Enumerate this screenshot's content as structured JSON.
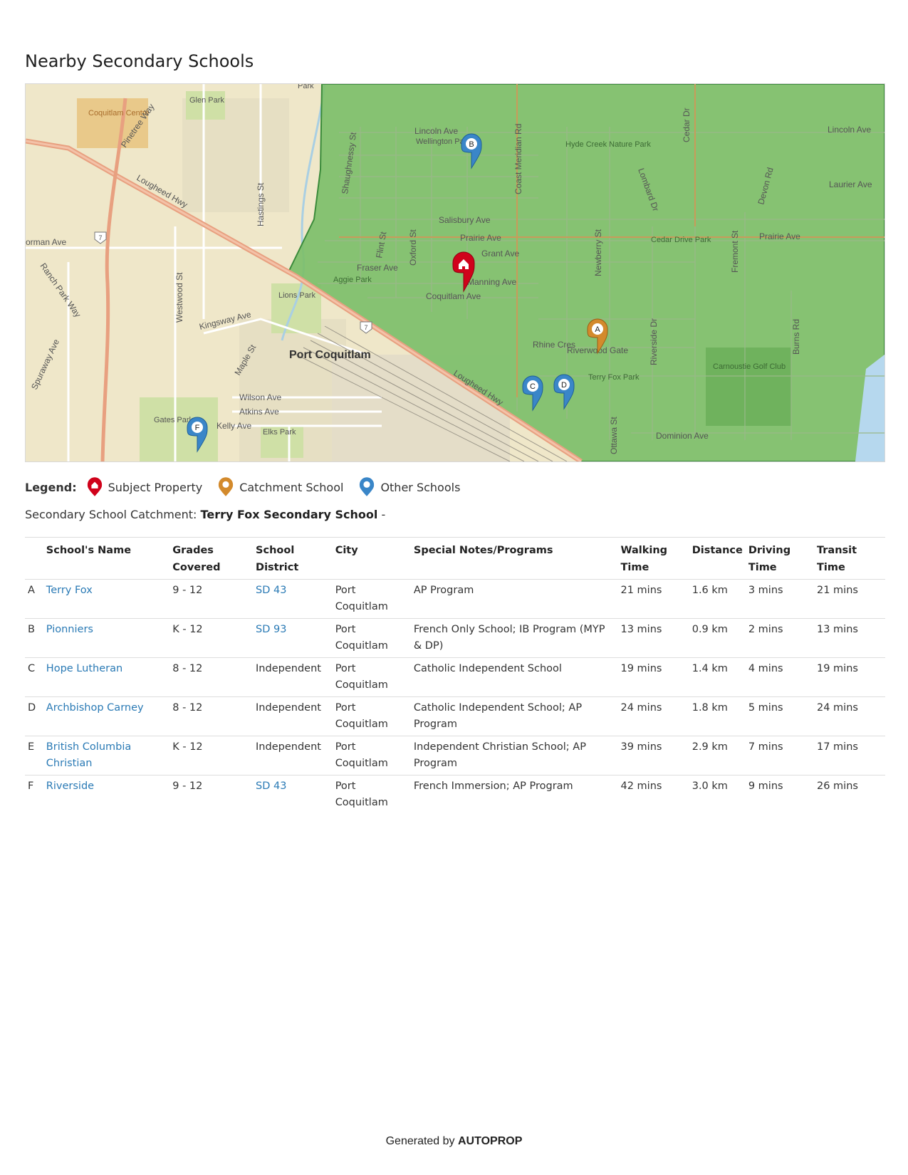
{
  "page_title": "Nearby Secondary Schools",
  "map": {
    "area_labels": {
      "glen_park": "Glen Park",
      "coquitlam_centre": "Coquitlam Centre",
      "port_coquitlam": "Port Coquitlam",
      "hyde_creek": "Hyde Creek Nature Park",
      "cedar_drive_park": "Cedar Drive Park",
      "lions_park": "Lions Park",
      "aggie_park": "Aggie Park",
      "terry_fox_park": "Terry Fox Park",
      "carnoustie": "Carnoustie Golf Club",
      "gates_park": "Gates Park",
      "elks_park": "Elks Park",
      "wellington_park": "Wellington Park",
      "park_top": "Park"
    },
    "street_labels": {
      "lincoln_ave": "Lincoln Ave",
      "lincoln_ave_east": "Lincoln Ave",
      "laurier_ave": "Laurier Ave",
      "salisbury_ave": "Salisbury Ave",
      "prairie_ave": "Prairie Ave",
      "prairie_ave_east": "Prairie Ave",
      "grant_ave": "Grant Ave",
      "fraser_ave": "Fraser Ave",
      "manning_ave": "Manning Ave",
      "coquitlam_ave": "Coquitlam Ave",
      "riverwood_gate": "Riverwood Gate",
      "dominion_ave": "Dominion Ave",
      "wilson_ave": "Wilson Ave",
      "atkins_ave": "Atkins Ave",
      "kelly_ave": "Kelly Ave",
      "kingsway_ave": "Kingsway Ave",
      "lougheed_hwy_w": "Lougheed Hwy",
      "lougheed_hwy_e": "Lougheed Hwy",
      "norman_ave": "orman Ave",
      "pinetree_way": "Pinetree Way",
      "hastings_st": "Hastings St",
      "westwood_st": "Westwood St",
      "ranch_park_way": "Ranch Park Way",
      "shaughnessy_st": "Shaughnessy St",
      "flint_st": "Flint St",
      "oxford_st": "Oxford St",
      "coast_meridian_rd": "Coast Meridian Rd",
      "newberry_st": "Newberry St",
      "cedar_dr": "Cedar Dr",
      "fremont_st": "Fremont St",
      "devon_rd": "Devon Rd",
      "riverside_dr": "Riverside Dr",
      "burns_rd": "Burns Rd",
      "ottawa_st": "Ottawa St",
      "mapl_st": "Maple St",
      "spuraway_ave": "Spuraway Ave",
      "lombard_dr": "Lombard Dr",
      "rhine_cres": "Rhine Cres",
      "route_7": "7"
    },
    "markers": {
      "a": "A",
      "b": "B",
      "c": "C",
      "d": "D",
      "f": "F"
    }
  },
  "legend": {
    "title": "Legend:",
    "subject": "Subject Property",
    "catchment": "Catchment School",
    "other": "Other Schools",
    "colors": {
      "subject": "#d0021b",
      "catchment": "#d38a2c",
      "other": "#3a86c8"
    }
  },
  "catchment": {
    "label": "Secondary School Catchment:",
    "school": "Terry Fox Secondary School",
    "suffix": "-"
  },
  "table": {
    "headers": {
      "name": "School's Name",
      "grades_1": "Grades",
      "grades_2": "Covered",
      "district_1": "School",
      "district_2": "District",
      "city": "City",
      "notes": "Special Notes/Programs",
      "walking_1": "Walking",
      "walking_2": "Time",
      "distance": "Distance",
      "driving_1": "Driving",
      "driving_2": "Time",
      "transit_1": "Transit",
      "transit_2": "Time"
    },
    "rows": [
      {
        "letter": "A",
        "name": "Terry Fox",
        "grades": "9 - 12",
        "district": "SD 43",
        "city": "Port Coquitlam",
        "notes": "AP Program",
        "walking": "21 mins",
        "distance": "1.6 km",
        "driving": "3 mins",
        "transit": "21 mins"
      },
      {
        "letter": "B",
        "name": "Pionniers",
        "grades": "K - 12",
        "district": "SD 93",
        "city": "Port Coquitlam",
        "notes": "French Only School; IB Program (MYP & DP)",
        "walking": "13 mins",
        "distance": "0.9 km",
        "driving": "2 mins",
        "transit": "13 mins"
      },
      {
        "letter": "C",
        "name": "Hope Lutheran",
        "grades": "8 - 12",
        "district": "Independent",
        "city": "Port Coquitlam",
        "notes": "Catholic Independent School",
        "walking": "19 mins",
        "distance": "1.4 km",
        "driving": "4 mins",
        "transit": "19 mins"
      },
      {
        "letter": "D",
        "name": "Archbishop Carney",
        "grades": "8 - 12",
        "district": "Independent",
        "city": "Port Coquitlam",
        "notes": "Catholic Independent School; AP Program",
        "walking": "24 mins",
        "distance": "1.8 km",
        "driving": "5 mins",
        "transit": "24 mins"
      },
      {
        "letter": "E",
        "name": "British Columbia Christian",
        "grades": "K - 12",
        "district": "Independent",
        "city": "Port Coquitlam",
        "notes": "Independent Christian School; AP Program",
        "walking": "39 mins",
        "distance": "2.9 km",
        "driving": "7 mins",
        "transit": "17 mins"
      },
      {
        "letter": "F",
        "name": "Riverside",
        "grades": "9 - 12",
        "district": "SD 43",
        "city": "Port Coquitlam",
        "notes": "French Immersion; AP Program",
        "walking": "42 mins",
        "distance": "3.0 km",
        "driving": "9 mins",
        "transit": "26 mins"
      }
    ]
  },
  "footer": {
    "prefix": "Generated by",
    "brand": "AUTOPROP"
  }
}
